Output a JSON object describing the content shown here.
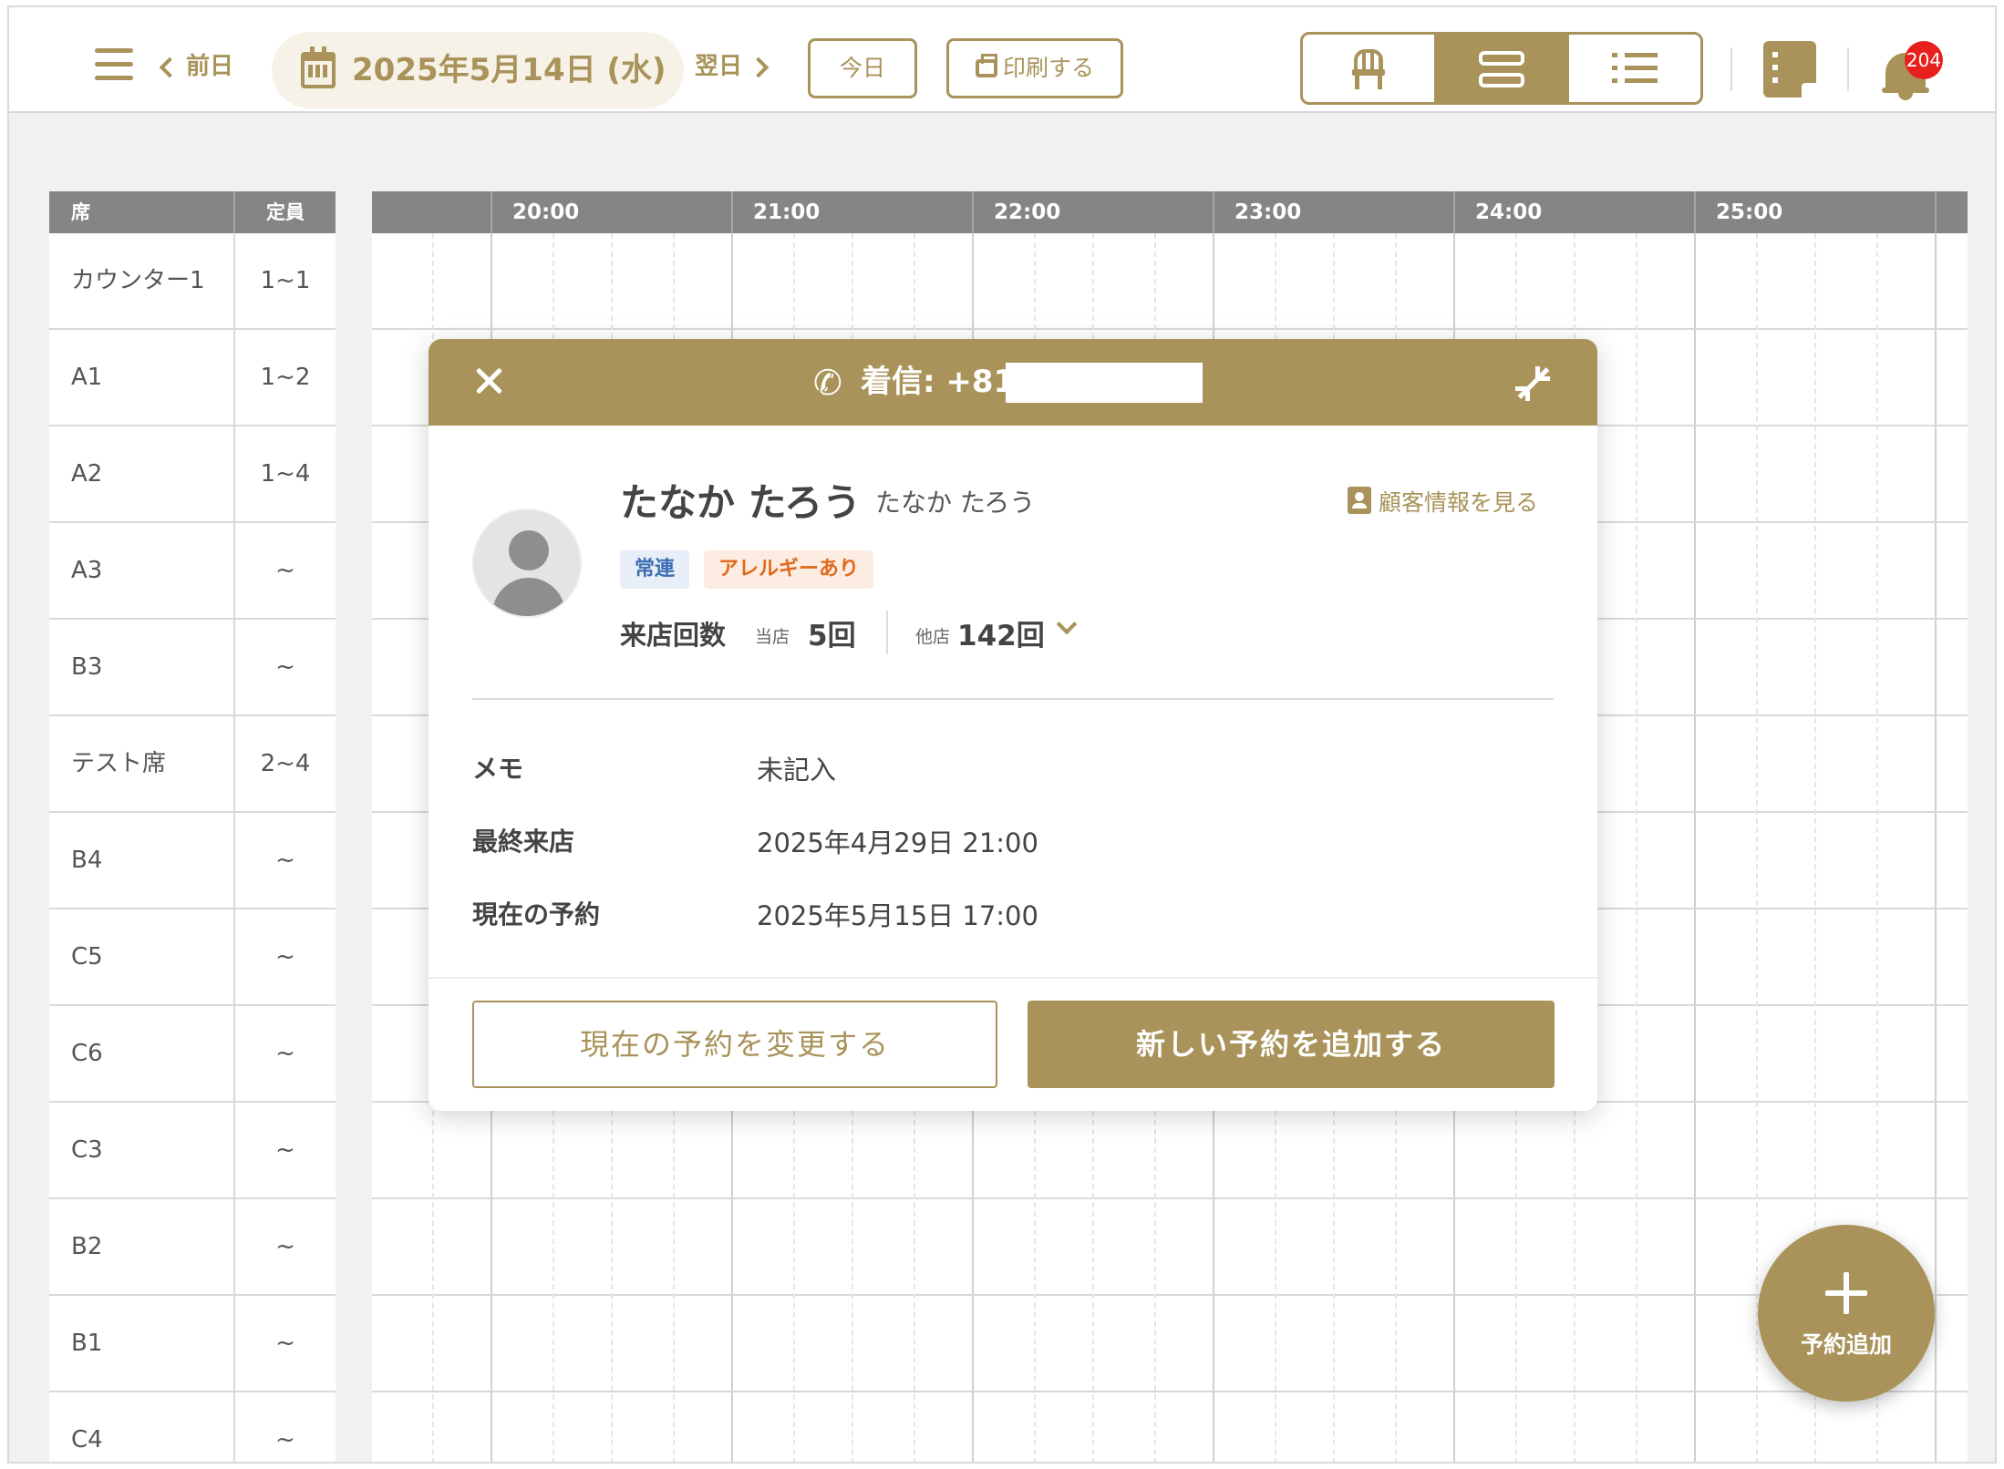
{
  "header": {
    "prev_label": "前日",
    "date": "2025年5月14日 (水)",
    "next_label": "翌日",
    "today_label": "今日",
    "print_label": "印刷する",
    "notification_count": "204"
  },
  "seats": {
    "header_seat": "席",
    "header_capacity": "定員",
    "rows": [
      {
        "name": "カウンター1",
        "capacity": "1~1"
      },
      {
        "name": "A1",
        "capacity": "1~2"
      },
      {
        "name": "A2",
        "capacity": "1~4"
      },
      {
        "name": "A3",
        "capacity": "~"
      },
      {
        "name": "B3",
        "capacity": "~"
      },
      {
        "name": "テスト席",
        "capacity": "2~4"
      },
      {
        "name": "B4",
        "capacity": "~"
      },
      {
        "name": "C5",
        "capacity": "~"
      },
      {
        "name": "C6",
        "capacity": "~"
      },
      {
        "name": "C3",
        "capacity": "~"
      },
      {
        "name": "B2",
        "capacity": "~"
      },
      {
        "name": "B1",
        "capacity": "~"
      },
      {
        "name": "C4",
        "capacity": "~"
      }
    ]
  },
  "timeline": {
    "hours": [
      "20:00",
      "21:00",
      "22:00",
      "23:00",
      "24:00",
      "25:00"
    ]
  },
  "modal": {
    "call_title": "着信: +81",
    "customer_name": "たなか たろう",
    "customer_kana": "たなか たろう",
    "view_customer_label": "顧客情報を見る",
    "tags": [
      "常連",
      "アレルギーあり"
    ],
    "visits_label": "来店回数",
    "this_store_label": "当店",
    "this_store_count": "5回",
    "other_store_label": "他店",
    "other_store_count": "142回",
    "memo_label": "メモ",
    "memo_value": "未記入",
    "last_visit_label": "最終来店",
    "last_visit_value": "2025年4月29日 21:00",
    "current_reservation_label": "現在の予約",
    "current_reservation_value": "2025年5月15日 17:00",
    "change_button": "現在の予約を変更する",
    "add_button": "新しい予約を追加する"
  },
  "fab": {
    "label": "予約追加"
  },
  "colors": {
    "accent": "#a9935a",
    "header_gray": "#858585",
    "badge_red": "#e8201c"
  }
}
